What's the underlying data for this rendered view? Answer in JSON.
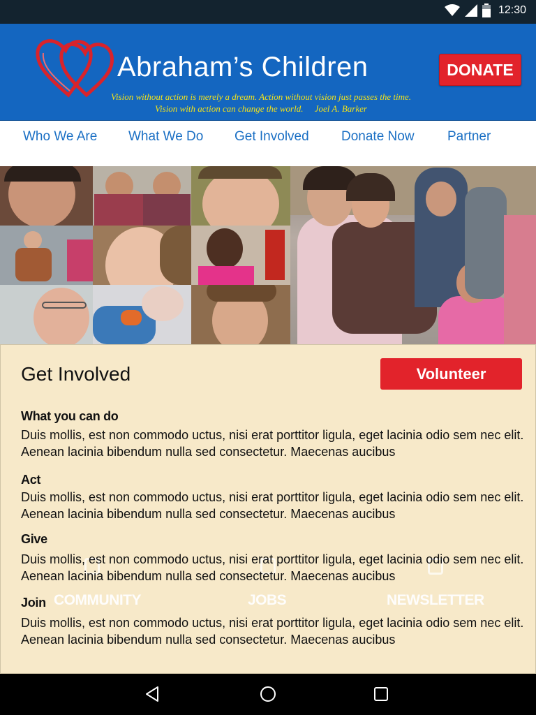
{
  "status_bar": {
    "time": "12:30"
  },
  "header": {
    "brand_name": "Abraham’s Children",
    "tagline_line1": "Vision without action is merely a dream. Action without vision just passes the time.",
    "tagline_line2": "Vision with action can change the world.     Joel A. Barker",
    "donate_label": "DONATE",
    "colors": {
      "header_bg": "#1466c0",
      "donate_bg": "#e2232b",
      "tagline": "#f2e21a"
    }
  },
  "nav": {
    "items": [
      {
        "label": "Who We Are"
      },
      {
        "label": "What We Do"
      },
      {
        "label": "Get Involved"
      },
      {
        "label": "Donate Now"
      },
      {
        "label": "Partner"
      }
    ]
  },
  "content": {
    "title": "Get Involved",
    "volunteer_label": "Volunteer",
    "blocks": [
      {
        "heading": "What you can do",
        "text": "Duis mollis, est non commodo uctus, nisi erat porttitor ligula, eget lacinia odio sem nec elit. Aenean lacinia bibendum nulla sed consectetur. Maecenas aucibus"
      },
      {
        "heading": "Act",
        "text": "Duis mollis, est non commodo uctus, nisi erat porttitor ligula, eget lacinia odio sem nec elit. Aenean lacinia bibendum nulla sed consectetur. Maecenas aucibus"
      },
      {
        "heading": "Give",
        "text": "Duis mollis, est non commodo uctus, nisi erat porttitor ligula, eget lacinia odio sem nec elit. Aenean lacinia bibendum nulla sed consectetur. Maecenas aucibus"
      },
      {
        "heading": "Join",
        "text": "Duis mollis, est non commodo uctus, nisi erat porttitor ligula, eget lacinia odio sem nec elit. Aenean lacinia bibendum nulla sed consectetur. Maecenas aucibus"
      }
    ],
    "ghost_labels": [
      "COMMUNITY",
      "JOBS",
      "NEWSLETTER"
    ],
    "colors": {
      "panel_bg": "#f7e9c9",
      "volunteer_bg": "#e2232b"
    }
  },
  "android_nav": {
    "icons": [
      "back-icon",
      "home-icon",
      "recents-icon"
    ]
  }
}
